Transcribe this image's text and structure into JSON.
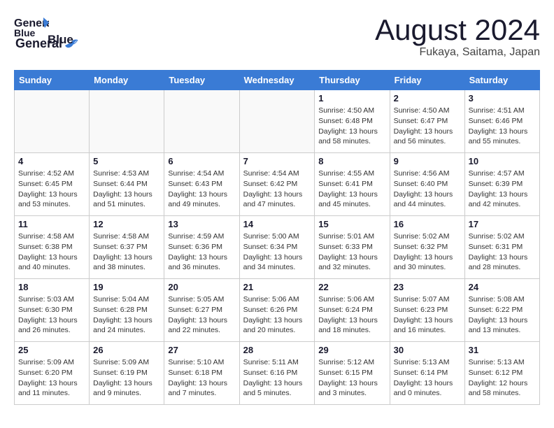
{
  "header": {
    "logo_line1": "General",
    "logo_line2": "Blue",
    "month_title": "August 2024",
    "location": "Fukaya, Saitama, Japan"
  },
  "weekdays": [
    "Sunday",
    "Monday",
    "Tuesday",
    "Wednesday",
    "Thursday",
    "Friday",
    "Saturday"
  ],
  "weeks": [
    [
      {
        "day": "",
        "info": ""
      },
      {
        "day": "",
        "info": ""
      },
      {
        "day": "",
        "info": ""
      },
      {
        "day": "",
        "info": ""
      },
      {
        "day": "1",
        "info": "Sunrise: 4:50 AM\nSunset: 6:48 PM\nDaylight: 13 hours\nand 58 minutes."
      },
      {
        "day": "2",
        "info": "Sunrise: 4:50 AM\nSunset: 6:47 PM\nDaylight: 13 hours\nand 56 minutes."
      },
      {
        "day": "3",
        "info": "Sunrise: 4:51 AM\nSunset: 6:46 PM\nDaylight: 13 hours\nand 55 minutes."
      }
    ],
    [
      {
        "day": "4",
        "info": "Sunrise: 4:52 AM\nSunset: 6:45 PM\nDaylight: 13 hours\nand 53 minutes."
      },
      {
        "day": "5",
        "info": "Sunrise: 4:53 AM\nSunset: 6:44 PM\nDaylight: 13 hours\nand 51 minutes."
      },
      {
        "day": "6",
        "info": "Sunrise: 4:54 AM\nSunset: 6:43 PM\nDaylight: 13 hours\nand 49 minutes."
      },
      {
        "day": "7",
        "info": "Sunrise: 4:54 AM\nSunset: 6:42 PM\nDaylight: 13 hours\nand 47 minutes."
      },
      {
        "day": "8",
        "info": "Sunrise: 4:55 AM\nSunset: 6:41 PM\nDaylight: 13 hours\nand 45 minutes."
      },
      {
        "day": "9",
        "info": "Sunrise: 4:56 AM\nSunset: 6:40 PM\nDaylight: 13 hours\nand 44 minutes."
      },
      {
        "day": "10",
        "info": "Sunrise: 4:57 AM\nSunset: 6:39 PM\nDaylight: 13 hours\nand 42 minutes."
      }
    ],
    [
      {
        "day": "11",
        "info": "Sunrise: 4:58 AM\nSunset: 6:38 PM\nDaylight: 13 hours\nand 40 minutes."
      },
      {
        "day": "12",
        "info": "Sunrise: 4:58 AM\nSunset: 6:37 PM\nDaylight: 13 hours\nand 38 minutes."
      },
      {
        "day": "13",
        "info": "Sunrise: 4:59 AM\nSunset: 6:36 PM\nDaylight: 13 hours\nand 36 minutes."
      },
      {
        "day": "14",
        "info": "Sunrise: 5:00 AM\nSunset: 6:34 PM\nDaylight: 13 hours\nand 34 minutes."
      },
      {
        "day": "15",
        "info": "Sunrise: 5:01 AM\nSunset: 6:33 PM\nDaylight: 13 hours\nand 32 minutes."
      },
      {
        "day": "16",
        "info": "Sunrise: 5:02 AM\nSunset: 6:32 PM\nDaylight: 13 hours\nand 30 minutes."
      },
      {
        "day": "17",
        "info": "Sunrise: 5:02 AM\nSunset: 6:31 PM\nDaylight: 13 hours\nand 28 minutes."
      }
    ],
    [
      {
        "day": "18",
        "info": "Sunrise: 5:03 AM\nSunset: 6:30 PM\nDaylight: 13 hours\nand 26 minutes."
      },
      {
        "day": "19",
        "info": "Sunrise: 5:04 AM\nSunset: 6:28 PM\nDaylight: 13 hours\nand 24 minutes."
      },
      {
        "day": "20",
        "info": "Sunrise: 5:05 AM\nSunset: 6:27 PM\nDaylight: 13 hours\nand 22 minutes."
      },
      {
        "day": "21",
        "info": "Sunrise: 5:06 AM\nSunset: 6:26 PM\nDaylight: 13 hours\nand 20 minutes."
      },
      {
        "day": "22",
        "info": "Sunrise: 5:06 AM\nSunset: 6:24 PM\nDaylight: 13 hours\nand 18 minutes."
      },
      {
        "day": "23",
        "info": "Sunrise: 5:07 AM\nSunset: 6:23 PM\nDaylight: 13 hours\nand 16 minutes."
      },
      {
        "day": "24",
        "info": "Sunrise: 5:08 AM\nSunset: 6:22 PM\nDaylight: 13 hours\nand 13 minutes."
      }
    ],
    [
      {
        "day": "25",
        "info": "Sunrise: 5:09 AM\nSunset: 6:20 PM\nDaylight: 13 hours\nand 11 minutes."
      },
      {
        "day": "26",
        "info": "Sunrise: 5:09 AM\nSunset: 6:19 PM\nDaylight: 13 hours\nand 9 minutes."
      },
      {
        "day": "27",
        "info": "Sunrise: 5:10 AM\nSunset: 6:18 PM\nDaylight: 13 hours\nand 7 minutes."
      },
      {
        "day": "28",
        "info": "Sunrise: 5:11 AM\nSunset: 6:16 PM\nDaylight: 13 hours\nand 5 minutes."
      },
      {
        "day": "29",
        "info": "Sunrise: 5:12 AM\nSunset: 6:15 PM\nDaylight: 13 hours\nand 3 minutes."
      },
      {
        "day": "30",
        "info": "Sunrise: 5:13 AM\nSunset: 6:14 PM\nDaylight: 13 hours\nand 0 minutes."
      },
      {
        "day": "31",
        "info": "Sunrise: 5:13 AM\nSunset: 6:12 PM\nDaylight: 12 hours\nand 58 minutes."
      }
    ]
  ]
}
